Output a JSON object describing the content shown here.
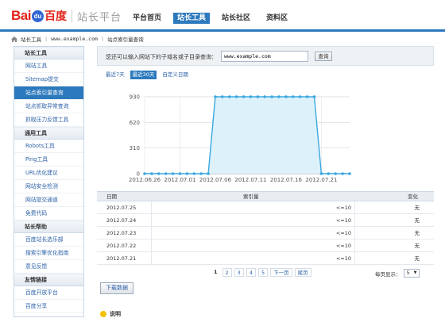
{
  "logo": {
    "bai": "Bai",
    "paw": "du",
    "du": "百度",
    "platform": "站长平台"
  },
  "nav": [
    "平台首页",
    "站长工具",
    "站长社区",
    "资料区"
  ],
  "nav_active": 1,
  "breadcrumb": {
    "home": "站长工具",
    "site": "www.example.com",
    "page": "站点索引量查询"
  },
  "sidebar": [
    {
      "section": "站长工具",
      "items": [
        "网站工具",
        "Sitemap提交",
        "站点索引量查询",
        "站点抓取异常查询",
        "抓取压力反馈工具"
      ]
    },
    {
      "section": "通用工具",
      "items": [
        "Robots工具",
        "Ping工具",
        "URL优化建议",
        "网站安全检测",
        "网站提交通道",
        "免费代码"
      ]
    },
    {
      "section": "站长帮助",
      "items": [
        "百度站长选乐部",
        "搜索引擎优化指南",
        "意见反馈"
      ]
    },
    {
      "section": "友情链接",
      "items": [
        "百度开放平台",
        "百度分享"
      ]
    }
  ],
  "sidebar_active": "站点索引量查询",
  "search": {
    "label": "您还可以输入网站下的子域名或子目录查询：",
    "value": "www.example.com",
    "button": "查询"
  },
  "tabs": [
    "最近7天",
    "最近30天",
    "自定义日期"
  ],
  "tab_active": 1,
  "chart_data": {
    "type": "area",
    "x": [
      "2012.06.26",
      "2012.06.27",
      "2012.06.28",
      "2012.06.29",
      "2012.06.30",
      "2012.07.01",
      "2012.07.02",
      "2012.07.03",
      "2012.07.04",
      "2012.07.05",
      "2012.07.06",
      "2012.07.07",
      "2012.07.08",
      "2012.07.09",
      "2012.07.10",
      "2012.07.11",
      "2012.07.12",
      "2012.07.13",
      "2012.07.14",
      "2012.07.15",
      "2012.07.16",
      "2012.07.17",
      "2012.07.18",
      "2012.07.19",
      "2012.07.20",
      "2012.07.21",
      "2012.07.22",
      "2012.07.23",
      "2012.07.24",
      "2012.07.25"
    ],
    "values": [
      0,
      0,
      0,
      0,
      0,
      0,
      0,
      0,
      0,
      0,
      930,
      930,
      930,
      930,
      930,
      930,
      930,
      930,
      930,
      930,
      930,
      930,
      930,
      930,
      930,
      0,
      0,
      0,
      0,
      0
    ],
    "xticks": [
      "2012.06.26",
      "2012.07.01",
      "2012.07.06",
      "2012.07.11",
      "2012.07.16",
      "2012.07.21"
    ],
    "yticks": [
      0,
      310,
      620,
      930
    ],
    "ylim": [
      0,
      930
    ],
    "grid": true,
    "line_color": "#3aa8e0",
    "fill_color": "#ddf1fb"
  },
  "table": {
    "headers": [
      "日期",
      "索引量",
      "变化"
    ],
    "rows": [
      [
        "2012.07.25",
        "<=10",
        "无"
      ],
      [
        "2012.07.24",
        "<=10",
        "无"
      ],
      [
        "2012.07.23",
        "<=10",
        "无"
      ],
      [
        "2012.07.22",
        "<=10",
        "无"
      ],
      [
        "2012.07.21",
        "<=10",
        "无"
      ]
    ]
  },
  "pager": {
    "pages": [
      "1",
      "2",
      "3",
      "4",
      "5"
    ],
    "next": "下一页",
    "last": "尾页",
    "perpage_label": "每页显示：",
    "perpage_value": "5"
  },
  "download": "下载数据",
  "note": "说明",
  "colors": {
    "accent": "#2c79bd",
    "link": "#2c62a8",
    "logo_red": "#e1251b",
    "logo_blue": "#2f64d4"
  }
}
